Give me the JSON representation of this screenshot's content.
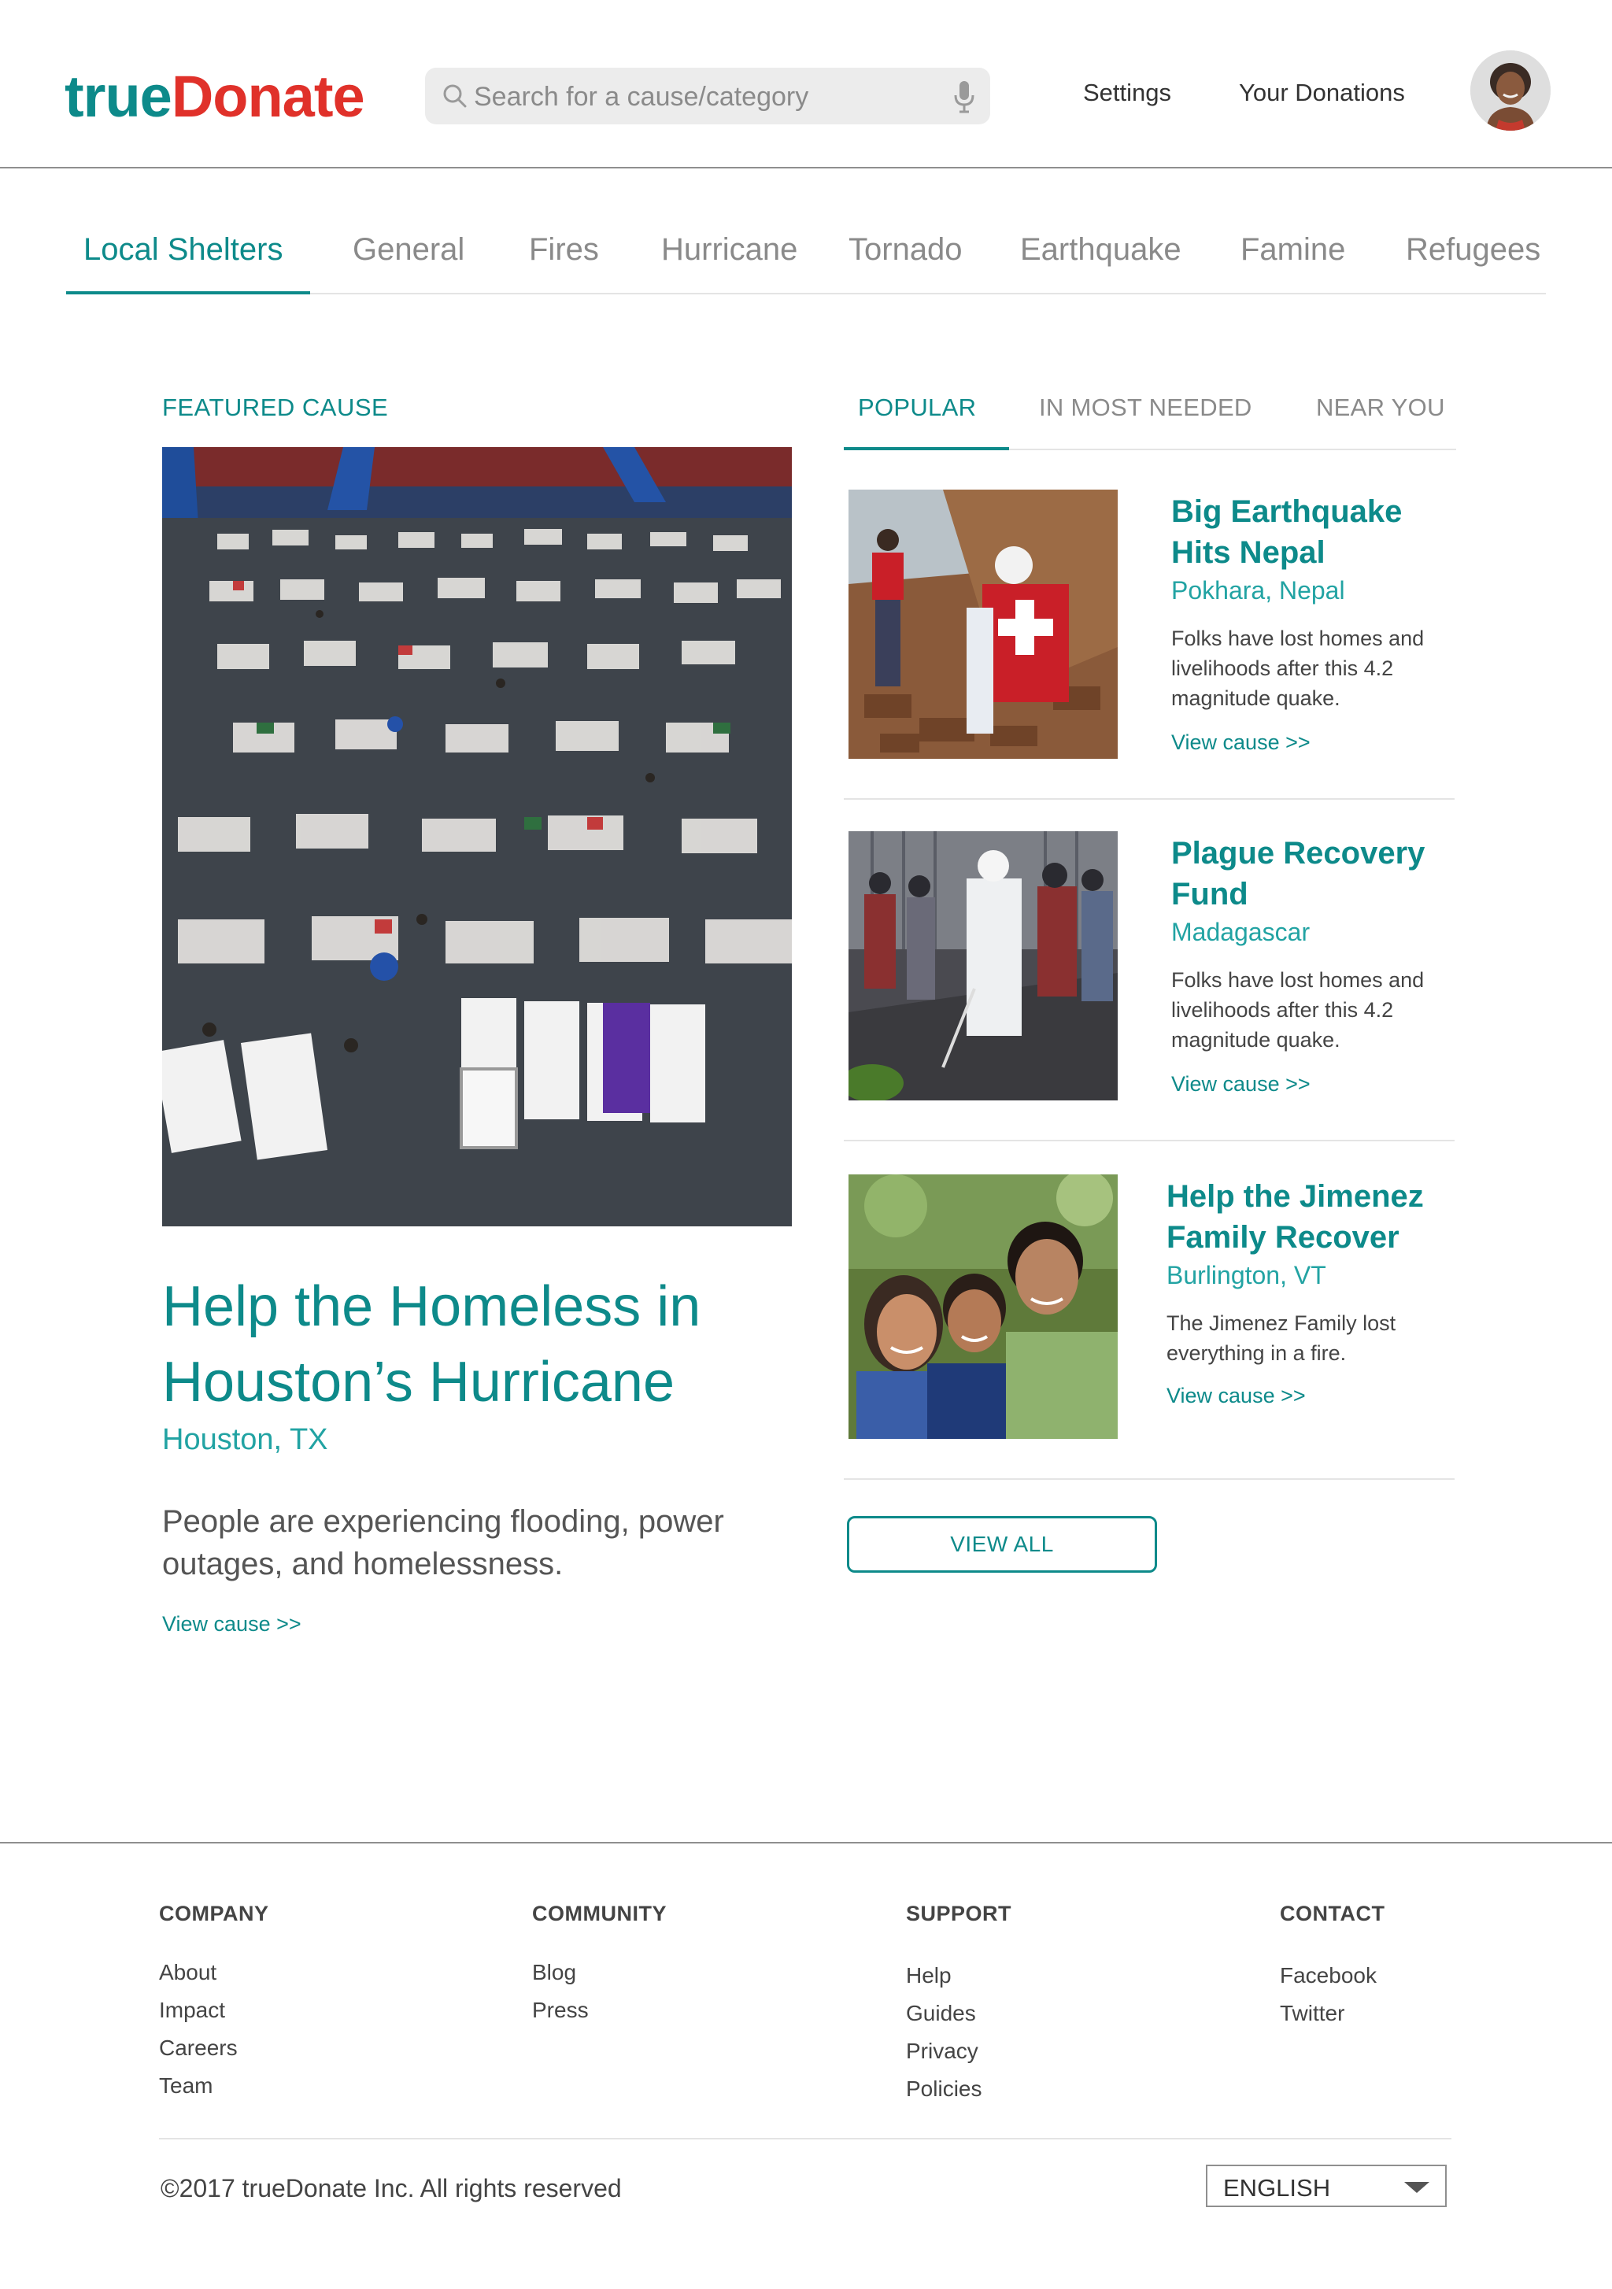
{
  "brand": {
    "logo_part1": "true",
    "logo_part2": "Donate",
    "primary_color": "#0d8a8a",
    "accent_color": "#e0312a"
  },
  "header": {
    "search_placeholder": "Search for a cause/category",
    "search_icon": "magnifier-icon",
    "mic_icon": "microphone-icon",
    "nav": [
      {
        "label": "Settings"
      },
      {
        "label": "Your Donations"
      }
    ],
    "avatar_icon": "user-avatar"
  },
  "categories": {
    "active": "Local Shelters",
    "tabs": [
      {
        "label": "Local Shelters"
      },
      {
        "label": "General"
      },
      {
        "label": "Fires"
      },
      {
        "label": "Hurricane"
      },
      {
        "label": "Tornado"
      },
      {
        "label": "Earthquake"
      },
      {
        "label": "Famine"
      },
      {
        "label": "Refugees"
      }
    ]
  },
  "featured": {
    "label": "FEATURED CAUSE",
    "title": "Help the Homeless in Houston’s Hurricane",
    "location": "Houston, TX",
    "description": "People are experiencing flooding, power outages, and homelessness.",
    "link": "View cause >>"
  },
  "side_tabs": {
    "active": "POPULAR",
    "tabs": [
      {
        "label": "POPULAR"
      },
      {
        "label": "IN MOST NEEDED"
      },
      {
        "label": "NEAR YOU"
      }
    ]
  },
  "causes": [
    {
      "title": "Big Earthquake Hits Nepal",
      "location": "Pokhara, Nepal",
      "description": "Folks have lost homes and livelihoods after this 4.2 magnitude quake.",
      "link": "View cause >>"
    },
    {
      "title": "Plague Recovery Fund",
      "location": "Madagascar",
      "description": "Folks have lost homes and livelihoods after this 4.2 magnitude quake.",
      "link": "View cause >>"
    },
    {
      "title": "Help the Jimenez Family Recover",
      "location": "Burlington, VT",
      "description": "The Jimenez Family lost everything in a fire.",
      "link": "View cause >>"
    }
  ],
  "view_all_label": "VIEW ALL",
  "footer": {
    "columns": [
      {
        "heading": "COMPANY",
        "links": [
          "About",
          "Impact",
          "Careers",
          "Team"
        ]
      },
      {
        "heading": "COMMUNITY",
        "links": [
          "Blog",
          "Press"
        ]
      },
      {
        "heading": "SUPPORT",
        "links": [
          "Help",
          "Guides",
          "Privacy",
          "Policies"
        ]
      },
      {
        "heading": "CONTACT",
        "links": [
          "Facebook",
          "Twitter"
        ]
      }
    ],
    "copyright": "©2017 trueDonate Inc. All rights reserved",
    "language": "ENGLISH"
  }
}
